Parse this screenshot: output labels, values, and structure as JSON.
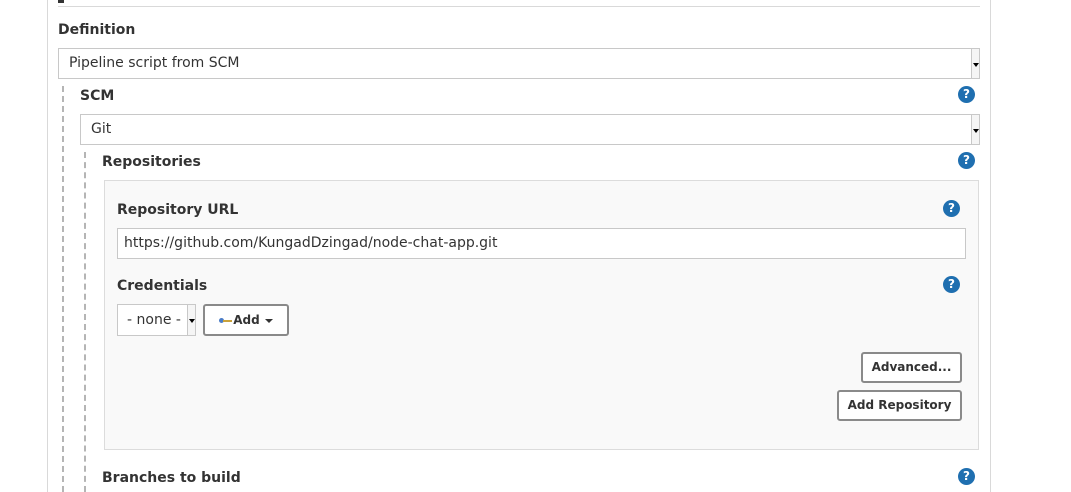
{
  "definition": {
    "label": "Definition",
    "selected": "Pipeline script from SCM"
  },
  "scm": {
    "label": "SCM",
    "selected": "Git"
  },
  "repositories": {
    "label": "Repositories",
    "repository_url_label": "Repository URL",
    "repository_url_value": "https://github.com/KungadDzingad/node-chat-app.git",
    "credentials_label": "Credentials",
    "credentials_selected": "- none -",
    "add_button_label": "Add",
    "advanced_button_label": "Advanced...",
    "add_repository_button_label": "Add Repository"
  },
  "branches": {
    "label": "Branches to build"
  },
  "icons": {
    "help": "help-icon",
    "add": "key-add-icon",
    "caret": "caret-down-icon"
  },
  "help_glyph": "?",
  "colors": {
    "help_icon": "#1f6fb0",
    "border": "#c8c8c8",
    "text": "#333333"
  }
}
